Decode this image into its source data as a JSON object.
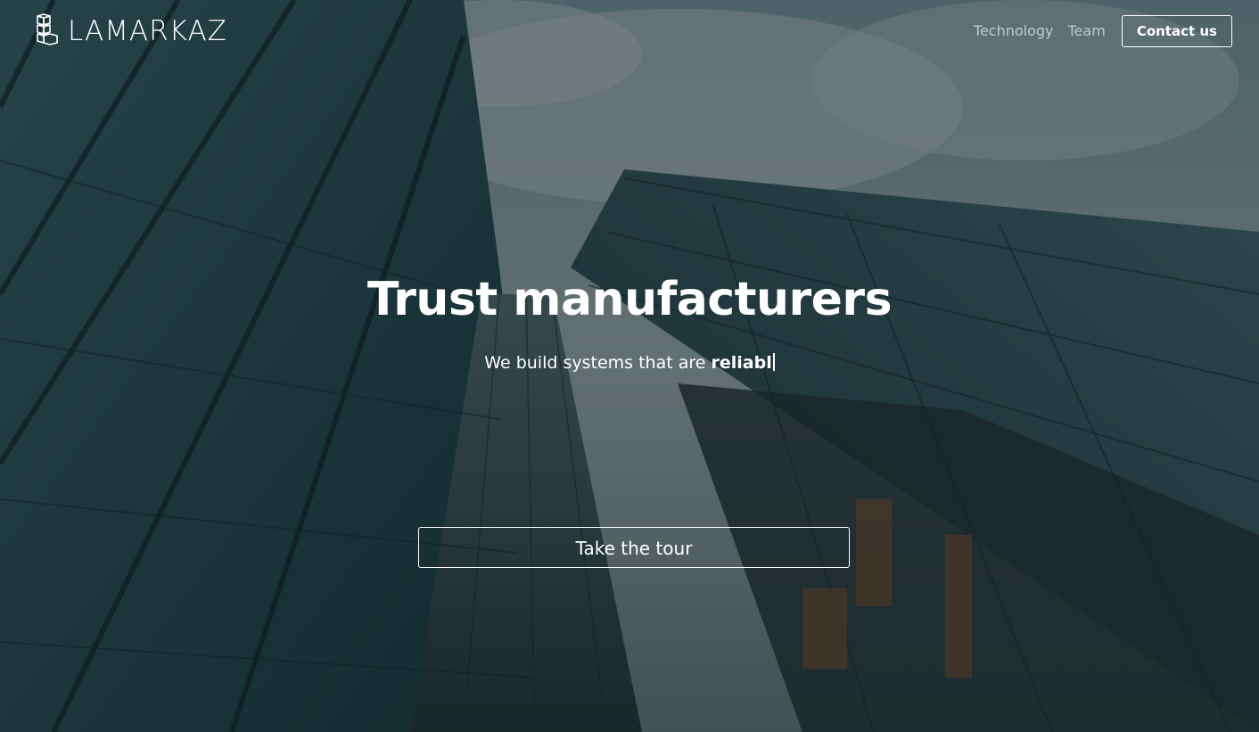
{
  "brand": {
    "name": "LAMARKAZ",
    "icon": "building-blocks-icon"
  },
  "nav": {
    "links": [
      {
        "label": "Technology"
      },
      {
        "label": "Team"
      }
    ],
    "contact_label": "Contact us"
  },
  "hero": {
    "headline": "Trust manufacturers",
    "tagline_prefix": "We build systems that are ",
    "tagline_typed": "reliabl",
    "cta_label": "Take the tour"
  },
  "colors": {
    "text": "#ffffff",
    "nav_link": "#a8b0b3",
    "background_teal": "#1f3b40"
  }
}
